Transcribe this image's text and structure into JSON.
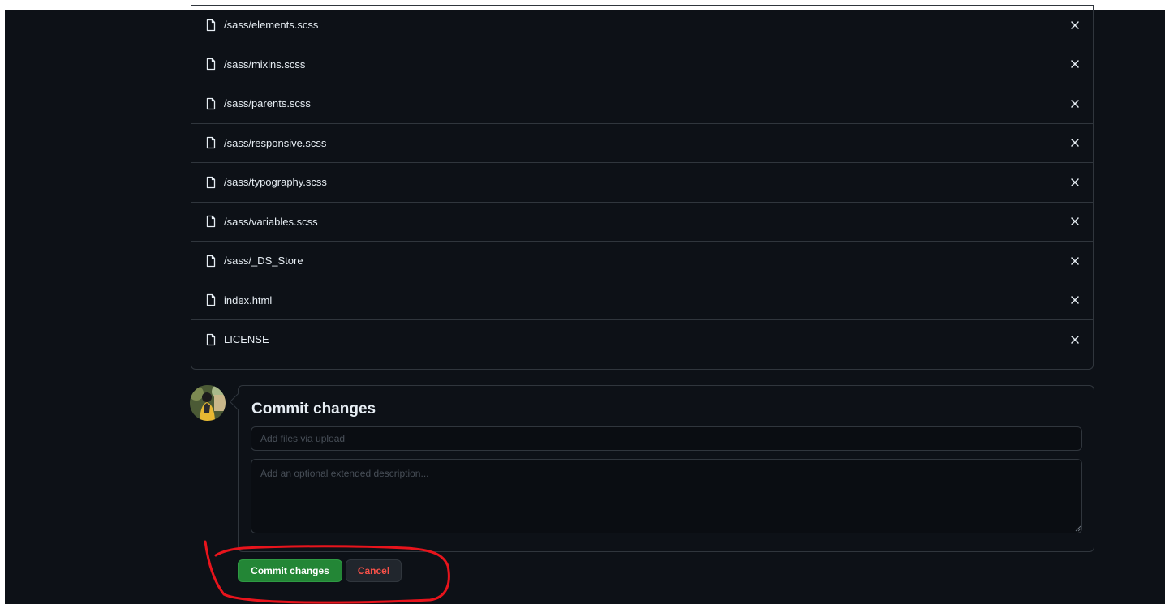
{
  "files": [
    {
      "name": "/sass/elements.scss"
    },
    {
      "name": "/sass/mixins.scss"
    },
    {
      "name": "/sass/parents.scss"
    },
    {
      "name": "/sass/responsive.scss"
    },
    {
      "name": "/sass/typography.scss"
    },
    {
      "name": "/sass/variables.scss"
    },
    {
      "name": "/sass/_DS_Store"
    },
    {
      "name": "index.html"
    },
    {
      "name": "LICENSE"
    }
  ],
  "icons": {
    "file": "file-icon",
    "remove": "close-icon",
    "avatar": "user-avatar"
  },
  "commit": {
    "title": "Commit changes",
    "summary_placeholder": "Add files via upload",
    "summary_value": "",
    "description_placeholder": "Add an optional extended description...",
    "description_value": "",
    "commit_button_label": "Commit changes",
    "cancel_button_label": "Cancel"
  },
  "colors": {
    "background": "#0d1117",
    "border": "#30363d",
    "primary_button": "#238636",
    "cancel_text": "#f85149",
    "annotation": "#e8141c"
  }
}
